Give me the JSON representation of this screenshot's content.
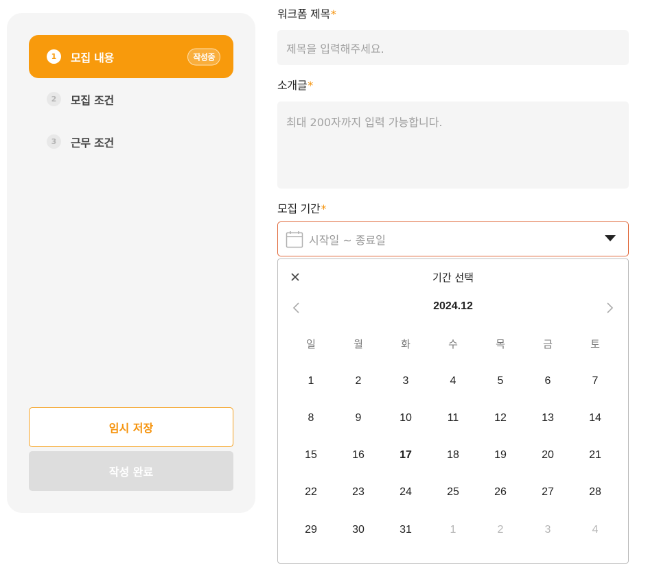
{
  "sidebar": {
    "steps": [
      {
        "num": "1",
        "label": "모집 내용",
        "badge": "작성중",
        "active": true
      },
      {
        "num": "2",
        "label": "모집 조건"
      },
      {
        "num": "3",
        "label": "근무 조건"
      }
    ],
    "save_label": "임시 저장",
    "done_label": "작성 완료"
  },
  "form": {
    "title_label": "워크폼 제목",
    "title_placeholder": "제목을 입력해주세요.",
    "intro_label": "소개글",
    "intro_placeholder": "최대 200자까지 입력 가능합니다.",
    "period_label": "모집 기간",
    "period_placeholder": "시작일 ~ 종료일",
    "required_mark": "*"
  },
  "calendar": {
    "title": "기간 선택",
    "month": "2024.12",
    "weekdays": [
      "일",
      "월",
      "화",
      "수",
      "목",
      "금",
      "토"
    ],
    "weeks": [
      [
        "1",
        "2",
        "3",
        "4",
        "5",
        "6",
        "7"
      ],
      [
        "8",
        "9",
        "10",
        "11",
        "12",
        "13",
        "14"
      ],
      [
        "15",
        "16",
        "17",
        "18",
        "19",
        "20",
        "21"
      ],
      [
        "22",
        "23",
        "24",
        "25",
        "26",
        "27",
        "28"
      ],
      [
        "29",
        "30",
        "31",
        "1",
        "2",
        "3",
        "4"
      ]
    ],
    "today": "17",
    "icons": {
      "close": "close-icon",
      "prev": "chevron-left-icon",
      "next": "chevron-right-icon",
      "calendar": "calendar-icon",
      "caret": "caret-down-icon"
    }
  },
  "colors": {
    "accent": "#f89a0c",
    "focus_border": "#e0683a",
    "sidebar_bg": "#f5f5f5",
    "disabled": "#dddddd"
  }
}
